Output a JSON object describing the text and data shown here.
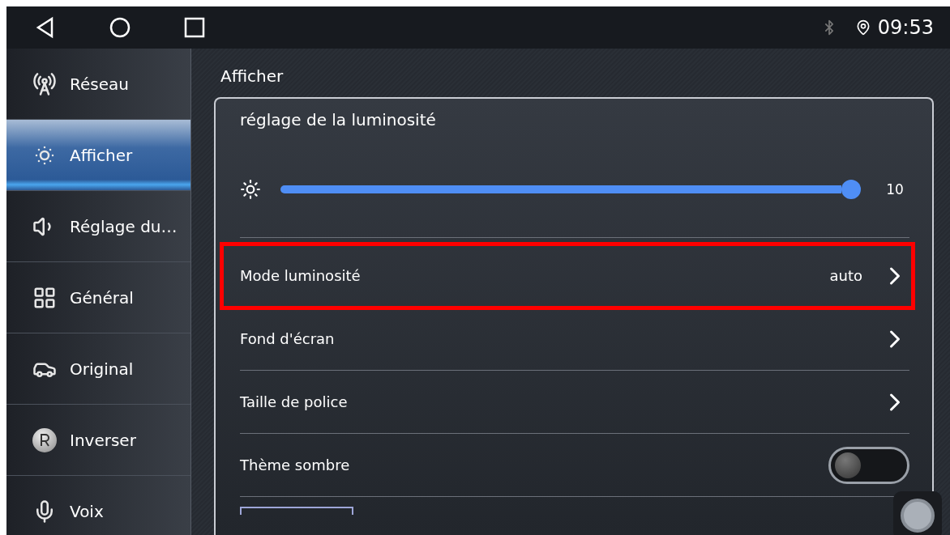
{
  "status_bar": {
    "time": "09:53"
  },
  "sidebar": {
    "items": [
      {
        "label": "Réseau",
        "selected": false
      },
      {
        "label": "Afficher",
        "selected": true
      },
      {
        "label": "Réglage du…",
        "selected": false
      },
      {
        "label": "Général",
        "selected": false
      },
      {
        "label": "Original",
        "selected": false
      },
      {
        "label": "Inverser",
        "selected": false
      },
      {
        "label": "Voix",
        "selected": false
      }
    ]
  },
  "content": {
    "title": "Afficher",
    "section_title": "réglage de la luminosité",
    "brightness": {
      "level": 1.0,
      "reading": "10"
    },
    "rows": [
      {
        "kind": "link",
        "label": "Mode luminosité",
        "value": "auto",
        "highlighted": true
      },
      {
        "kind": "link",
        "label": "Fond d'écran",
        "highlighted": false
      },
      {
        "kind": "link",
        "label": "Taille de police",
        "highlighted": false
      },
      {
        "kind": "toggle",
        "label": "Thème sombre",
        "on": false,
        "highlighted": false
      }
    ]
  }
}
